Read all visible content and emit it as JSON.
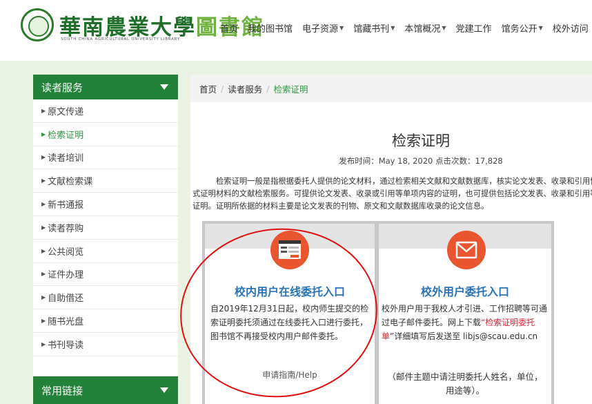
{
  "header": {
    "logo_title_main": "華南農業大學",
    "logo_title_lib": "圖書館",
    "logo_subtitle": "SOUTH CHINA AGRICULTURAL UNIVERSITY LIBRARY",
    "nav": [
      {
        "label": "首页",
        "dropdown": false
      },
      {
        "label": "我的图书馆",
        "dropdown": false
      },
      {
        "label": "电子资源",
        "dropdown": true
      },
      {
        "label": "馆藏书刊",
        "dropdown": true
      },
      {
        "label": "本馆概况",
        "dropdown": true
      },
      {
        "label": "党建工作",
        "dropdown": false
      },
      {
        "label": "馆务公开",
        "dropdown": true
      },
      {
        "label": "校外访问",
        "dropdown": false
      }
    ]
  },
  "sidebar": {
    "heading": "读者服务",
    "items": [
      {
        "label": "原文传递",
        "active": false
      },
      {
        "label": "检索证明",
        "active": true
      },
      {
        "label": "读者培训",
        "active": false
      },
      {
        "label": "文献检索课",
        "active": false
      },
      {
        "label": "新书通报",
        "active": false
      },
      {
        "label": "读者荐购",
        "active": false
      },
      {
        "label": "公共阅览",
        "active": false
      },
      {
        "label": "证件办理",
        "active": false
      },
      {
        "label": "自助借还",
        "active": false
      },
      {
        "label": "随书光盘",
        "active": false
      },
      {
        "label": "书刊导读",
        "active": false
      }
    ],
    "heading2": "常用链接"
  },
  "breadcrumb": {
    "home": "首页",
    "section": "读者服务",
    "current": "检索证明",
    "separator": "/"
  },
  "article": {
    "title": "检索证明",
    "meta": "发布时间：May 18, 2020 点击次数：17,828",
    "para_line1": "检索证明一般是指根据委托人提供的论文材料，通过检索相关文献和文献数据库，核实论文发表、收录和引用情",
    "para_line2": "式证明材料的文献检索服务。可提供论文发表、收录或引用等单项内容的证明，也可提供包括论文发表、收录和引用等",
    "para_line3": "证明。证明所依据的材料主要是论文发表的刊物、原文和文献数据库收录的论文信息。"
  },
  "cards": {
    "internal": {
      "title": "校内用户在线委托入口",
      "text": "自2019年12月31日起，校内师生提交的检索证明委托须通过在线委托入口进行委托，图书馆不再接受校内用户邮件委托。",
      "link": "申请指南/Help",
      "icon": "form-screen-icon"
    },
    "external": {
      "title": "校外用户委托入口",
      "text_a": "校外用户用于我校人才引进、工作招聘等可通过电子邮件委托。网上下载",
      "text_link": "“检索证明委托单",
      "text_b": "”详细填写后发送至 libjs@scau.edu.cn",
      "note": "（邮件主题中请注明委托人姓名，单位，用途等）。",
      "icon": "envelope-icon"
    }
  },
  "colors": {
    "sidebar_green": "#23823a",
    "active_green": "#2b9a3f",
    "card_title_blue": "#2a73b8",
    "icon_orange": "#e8552f",
    "annotation_red": "#e01010"
  }
}
